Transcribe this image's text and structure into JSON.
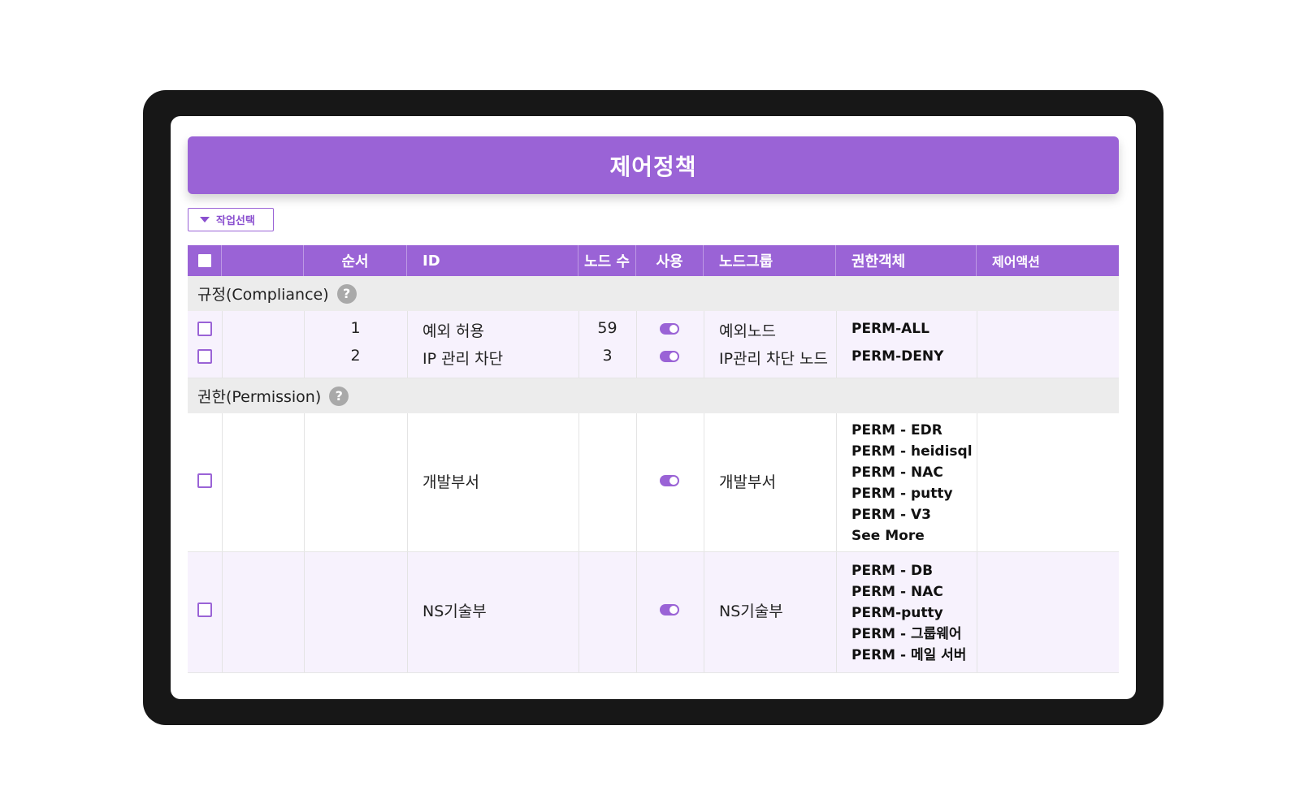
{
  "title": "제어정책",
  "action_select": {
    "label": "작업선택"
  },
  "columns": [
    "순서",
    "ID",
    "노드 수",
    "사용",
    "노드그룹",
    "권한객체",
    "제어액션"
  ],
  "sections": [
    {
      "label": "규정(Compliance)",
      "rows": [
        {
          "order": "1",
          "id": "예외 허용",
          "nodes": "59",
          "enabled": true,
          "group": "예외노드",
          "perms": [
            "PERM-ALL"
          ]
        },
        {
          "order": "2",
          "id": "IP 관리 차단",
          "nodes": "3",
          "enabled": true,
          "group": "IP관리 차단 노드",
          "perms": [
            "PERM-DENY"
          ]
        }
      ]
    },
    {
      "label": "권한(Permission)",
      "rows": [
        {
          "order": "",
          "id": "개발부서",
          "nodes": "",
          "enabled": true,
          "group": "개발부서",
          "perms": [
            "PERM - EDR",
            "PERM - heidisql",
            "PERM - NAC",
            "PERM - putty",
            "PERM - V3",
            "See More"
          ]
        },
        {
          "order": "",
          "id": "NS기술부",
          "nodes": "",
          "enabled": true,
          "group": "NS기술부",
          "perms": [
            "PERM - DB",
            "PERM - NAC",
            "PERM-putty",
            "PERM - 그룹웨어",
            "PERM - 메일 서버"
          ]
        }
      ]
    }
  ],
  "colors": {
    "accent": "#9a63d6",
    "section_bg": "#ececec",
    "row_alt_bg": "#f7f2fd"
  },
  "help_icon_text": "?"
}
